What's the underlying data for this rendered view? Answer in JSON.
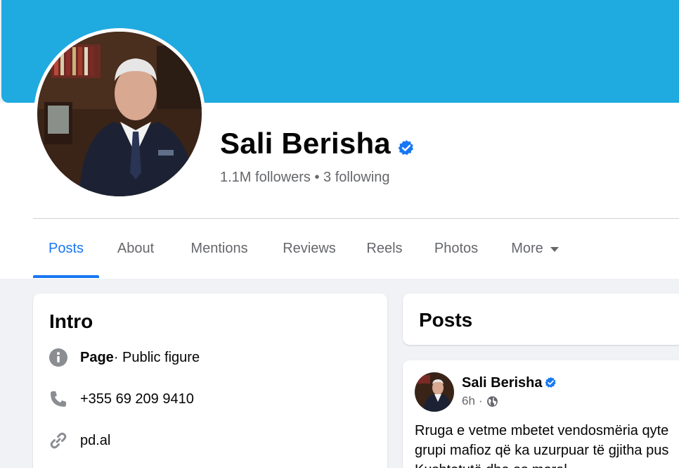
{
  "colors": {
    "cover": "#1faae0",
    "accent": "#1877f2",
    "secondary_text": "#65676b"
  },
  "profile": {
    "name": "Sali Berisha",
    "verified": true,
    "follow_stats": "1.1M followers • 3 following"
  },
  "tabs": [
    {
      "label": "Posts",
      "active": true
    },
    {
      "label": "About"
    },
    {
      "label": "Mentions"
    },
    {
      "label": "Reviews"
    },
    {
      "label": "Reels"
    },
    {
      "label": "Photos"
    },
    {
      "label": "More"
    }
  ],
  "intro": {
    "title": "Intro",
    "rows": [
      {
        "icon": "info-icon",
        "bold": "Page",
        "text": " · Public figure"
      },
      {
        "icon": "phone-icon",
        "text": "+355 69 209 9410"
      },
      {
        "icon": "link-icon",
        "text": "pd.al"
      }
    ]
  },
  "posts_section": {
    "title": "Posts"
  },
  "post": {
    "author": "Sali Berisha",
    "time": "6h",
    "separator": "·",
    "privacy_icon": "globe-icon",
    "text_lines": [
      "Rruga e vetme mbetet vendosmëria qyte",
      "grupi mafioz që ka uzurpuar të gjitha pus",
      "Kushtetutë dhe as moral"
    ]
  }
}
